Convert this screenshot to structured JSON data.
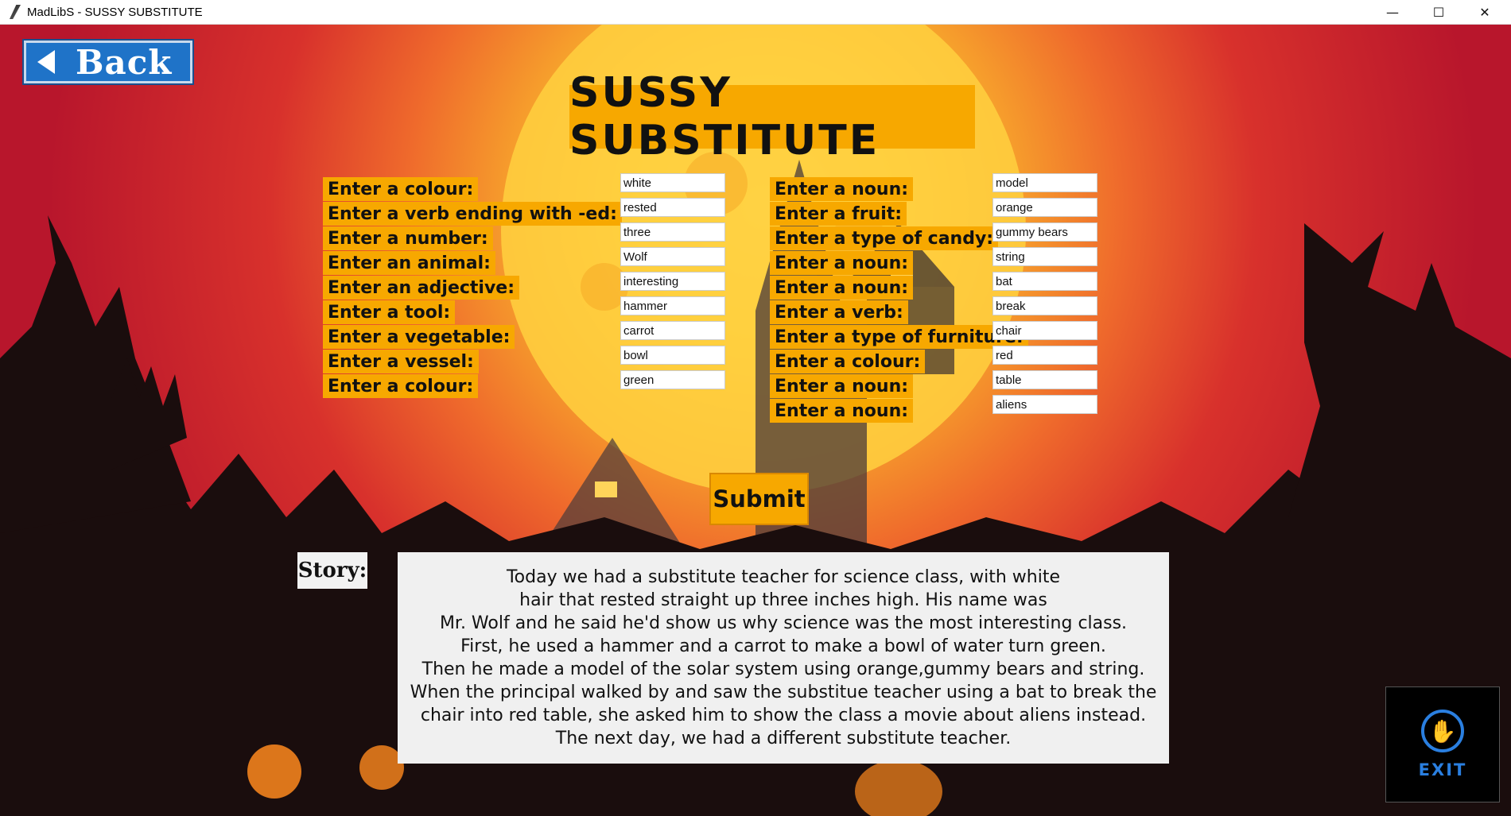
{
  "window": {
    "title": "MadLibS - SUSSY SUBSTITUTE",
    "minimize_glyph": "—",
    "maximize_glyph": "☐",
    "close_glyph": "✕"
  },
  "back_button": {
    "label": "Back",
    "icon": "arrow-left-icon"
  },
  "page_title": "SUSSY SUBSTITUTE",
  "left_fields": [
    {
      "label": "Enter a colour:",
      "value": "white"
    },
    {
      "label": "Enter a verb ending with -ed:",
      "value": "rested"
    },
    {
      "label": "Enter a number:",
      "value": "three"
    },
    {
      "label": "Enter an animal:",
      "value": "Wolf"
    },
    {
      "label": "Enter an adjective:",
      "value": "interesting"
    },
    {
      "label": "Enter a tool:",
      "value": "hammer"
    },
    {
      "label": "Enter a vegetable:",
      "value": "carrot"
    },
    {
      "label": "Enter a vessel:",
      "value": "bowl"
    },
    {
      "label": "Enter a colour:",
      "value": "green"
    }
  ],
  "right_fields": [
    {
      "label": "Enter a noun:",
      "value": "model"
    },
    {
      "label": "Enter a fruit:",
      "value": "orange"
    },
    {
      "label": "Enter a type of candy:",
      "value": "gummy bears"
    },
    {
      "label": "Enter a noun:",
      "value": "string"
    },
    {
      "label": "Enter a noun:",
      "value": "bat"
    },
    {
      "label": "Enter a verb:",
      "value": "break"
    },
    {
      "label": "Enter a type of furniture:",
      "value": "chair"
    },
    {
      "label": "Enter a colour:",
      "value": "red"
    },
    {
      "label": "Enter a noun:",
      "value": "table"
    },
    {
      "label": "Enter a noun:",
      "value": "aliens"
    }
  ],
  "submit_label": "Submit",
  "story_label": "Story:",
  "story_lines": [
    "Today we had a substitute teacher for science class, with white",
    "hair that rested straight up three inches high. His name was",
    "Mr. Wolf and he said he'd show us why science was the most interesting class.",
    "First, he used a hammer and a carrot to make a bowl of water turn green.",
    "Then he made a model of the solar system using orange,gummy bears and string.",
    "When the principal walked by and saw the substitue teacher using a bat to break the",
    "chair into red table, she asked him to show the class a movie about aliens instead.",
    "The next day, we had a different substitute teacher."
  ],
  "exit_button": {
    "label": "EXIT",
    "icon": "hand-stop-icon"
  },
  "colors": {
    "label_bg": "#f7a800",
    "back_blue": "#1f73c8",
    "exit_blue": "#2a7fe0"
  }
}
